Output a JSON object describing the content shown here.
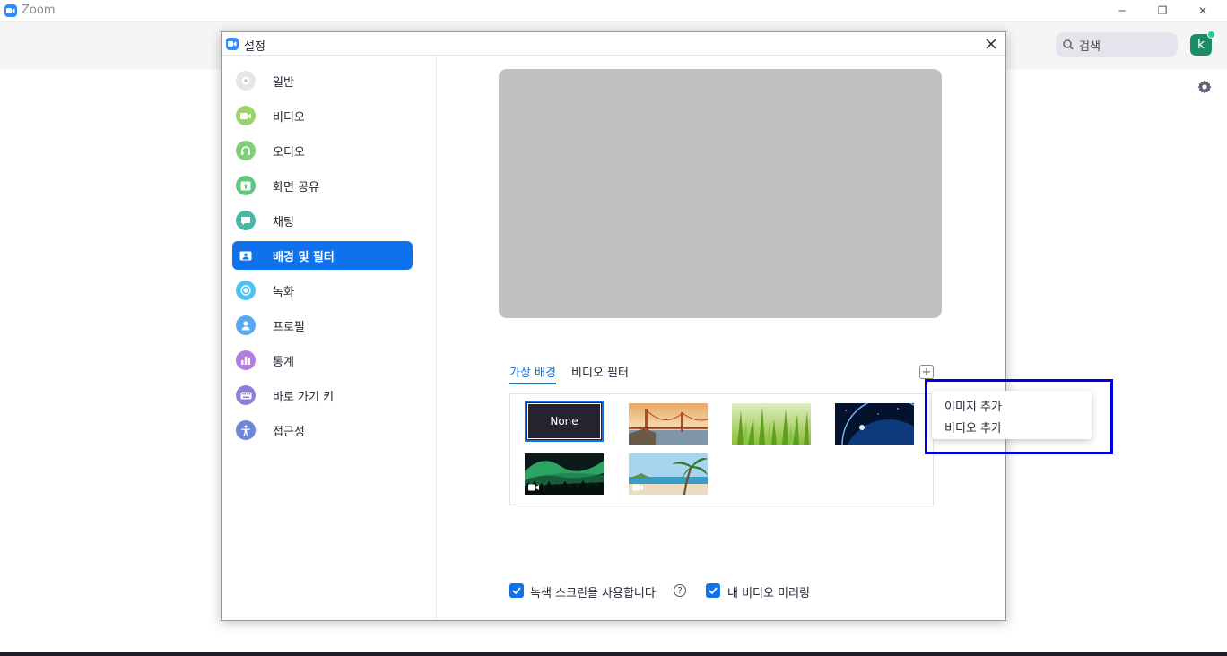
{
  "window": {
    "title": "Zoom",
    "controls": [
      "─",
      "❐",
      "✕"
    ]
  },
  "topbar": {
    "search_label": "검색",
    "avatar_initial": "k"
  },
  "dialog": {
    "title": "설정",
    "close": "✕"
  },
  "nav": {
    "items": [
      {
        "label": "일반",
        "icon": "gear-icon",
        "color": "#e6e6e6",
        "active": false
      },
      {
        "label": "비디오",
        "icon": "video-icon",
        "color": "#9bd46a",
        "active": false
      },
      {
        "label": "오디오",
        "icon": "headphones-icon",
        "color": "#7fcf7a",
        "active": false
      },
      {
        "label": "화면 공유",
        "icon": "share-screen-icon",
        "color": "#5fc67c",
        "active": false
      },
      {
        "label": "채팅",
        "icon": "chat-icon",
        "color": "#45b9a6",
        "active": false
      },
      {
        "label": "배경 및 필터",
        "icon": "background-icon",
        "color": "#ffffff",
        "active": true
      },
      {
        "label": "녹화",
        "icon": "record-icon",
        "color": "#4cc1f4",
        "active": false
      },
      {
        "label": "프로필",
        "icon": "profile-icon",
        "color": "#56a9f0",
        "active": false
      },
      {
        "label": "통계",
        "icon": "stats-icon",
        "color": "#b57de0",
        "active": false
      },
      {
        "label": "바로 가기 키",
        "icon": "keyboard-icon",
        "color": "#8b7fdc",
        "active": false
      },
      {
        "label": "접근성",
        "icon": "accessibility-icon",
        "color": "#6f86d6",
        "active": false
      }
    ]
  },
  "tabs": [
    {
      "label": "가상 배경",
      "active": true
    },
    {
      "label": "비디오 필터",
      "active": false
    }
  ],
  "add_button": "+",
  "backgrounds": {
    "none_label": "None",
    "items": [
      {
        "name": "none",
        "kind": "image"
      },
      {
        "name": "golden-gate-bridge",
        "kind": "image"
      },
      {
        "name": "grass",
        "kind": "image"
      },
      {
        "name": "earth-from-space",
        "kind": "image"
      },
      {
        "name": "aurora",
        "kind": "video"
      },
      {
        "name": "beach-palm",
        "kind": "video"
      }
    ]
  },
  "context_menu": {
    "items": [
      "이미지 추가",
      "비디오 추가"
    ],
    "highlight_color": "#0000e0"
  },
  "options": {
    "green_screen_label": "녹색 스크린을 사용합니다",
    "green_screen_checked": true,
    "help": "?",
    "mirror_label": "내 비디오 미러링",
    "mirror_checked": true
  },
  "colors": {
    "accent": "#0e72ed",
    "preview": "#c1c1c1"
  }
}
